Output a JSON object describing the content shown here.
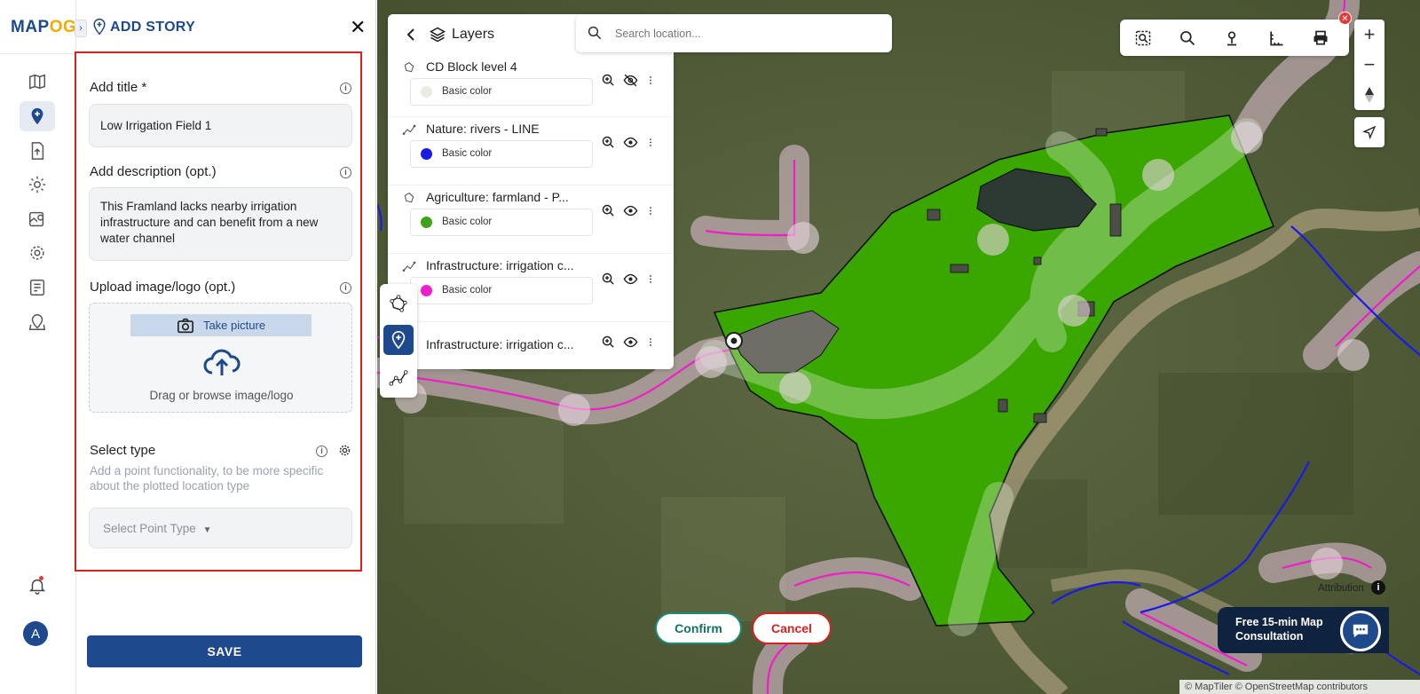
{
  "app": {
    "logo_main": "MAP",
    "logo_accent": "OG"
  },
  "panel": {
    "title": "ADD STORY",
    "title_field": {
      "label": "Add title *",
      "value": "Low Irrigation Field 1"
    },
    "description_field": {
      "label": "Add description (opt.)",
      "value": "This Framland lacks nearby irrigation infrastructure and can benefit from a new water channel"
    },
    "upload": {
      "label": "Upload image/logo (opt.)",
      "take_picture": "Take picture",
      "drag_text": "Drag or browse image/logo"
    },
    "select_type": {
      "label": "Select type",
      "helper": "Add a point functionality, to be more specific about the plotted location type",
      "placeholder": "Select Point Type"
    },
    "save_label": "SAVE"
  },
  "rail": {
    "avatar_letter": "A"
  },
  "layers": {
    "title": "Layers",
    "items": [
      {
        "name": "CD Block level 4",
        "color_label": "Basic color",
        "color": "#ecebdf",
        "visible": false
      },
      {
        "name": "Nature: rivers - LINE",
        "color_label": "Basic color",
        "color": "#1a1ae6",
        "visible": true
      },
      {
        "name": "Agriculture: farmland - P...",
        "color_label": "Basic color",
        "color": "#3fa31a",
        "visible": true
      },
      {
        "name": "Infrastructure: irrigation c...",
        "color_label": "Basic color",
        "color": "#ee1ecf",
        "visible": true
      },
      {
        "name": "Infrastructure: irrigation c...",
        "color_label": "",
        "color": "",
        "visible": true
      }
    ]
  },
  "search": {
    "placeholder": "Search location..."
  },
  "map": {
    "confirm_label": "Confirm",
    "cancel_label": "Cancel",
    "attribution_label": "Attribution",
    "consult_line1": "Free 15-min Map",
    "consult_line2": "Consultation",
    "copyright": "© MapTiler © OpenStreetMap contributors",
    "zoom_in": "+",
    "zoom_out": "−"
  },
  "colors": {
    "brand": "#1e4a8d",
    "danger": "#d92020",
    "confirm": "#1a8a7a",
    "farmland": "#3aa600"
  }
}
